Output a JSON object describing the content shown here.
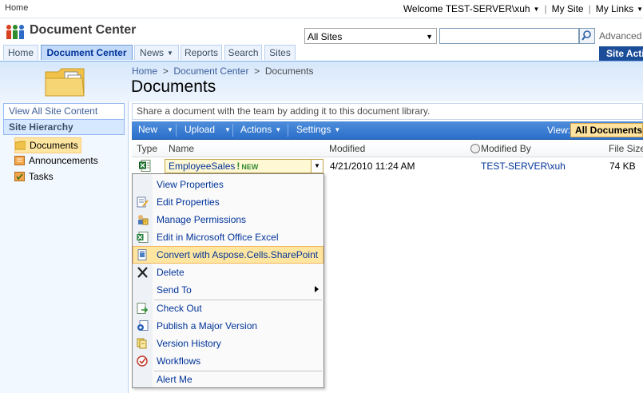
{
  "topbar": {
    "home": "Home",
    "welcome": "Welcome TEST-SERVER\\xuh",
    "my_site": "My Site",
    "my_links": "My Links"
  },
  "header": {
    "site_title": "Document Center",
    "search_scope": "All Sites",
    "search_value": "",
    "advanced_search": "Advanced S"
  },
  "tabs": [
    "Home",
    "Document Center",
    "News",
    "Reports",
    "Search",
    "Sites"
  ],
  "site_actions": "Site Acti",
  "breadcrumb": [
    "Home",
    "Document Center",
    "Documents"
  ],
  "page_title": "Documents",
  "leftnav": {
    "view_all": "View All Site Content",
    "heading": "Site Hierarchy",
    "items": [
      "Documents",
      "Announcements",
      "Tasks"
    ]
  },
  "description": "Share a document with the team by adding it to this document library.",
  "toolbar": {
    "new": "New",
    "upload": "Upload",
    "actions": "Actions",
    "settings": "Settings",
    "view_label": "View:",
    "view_value": "All Documents"
  },
  "columns": {
    "type": "Type",
    "name": "Name",
    "modified": "Modified",
    "modified_by": "Modified By",
    "file_size": "File Size"
  },
  "row": {
    "name": "EmployeeSales",
    "bang": "!",
    "new_tag": "NEW",
    "modified": "4/21/2010 11:24 AM",
    "modified_by": "TEST-SERVER\\xuh",
    "file_size": "74 KB"
  },
  "menu": {
    "items": [
      "View Properties",
      "Edit Properties",
      "Manage Permissions",
      "Edit in Microsoft Office Excel",
      "Convert with Aspose.Cells.SharePoint",
      "Delete",
      "Send To",
      "Check Out",
      "Publish a Major Version",
      "Version History",
      "Workflows",
      "Alert Me"
    ],
    "highlighted": "Convert with Aspose.Cells.SharePoint"
  },
  "colors": {
    "toolbar_blue": "#2a6fc9",
    "highlight": "#ffe6a0",
    "link": "#003399",
    "site_actions": "#1c4d98"
  }
}
